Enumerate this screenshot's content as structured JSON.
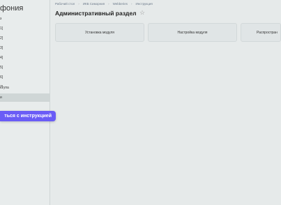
{
  "sidebar": {
    "title": "фония",
    "items": [
      {
        "label": "з"
      },
      {
        "label": "1]"
      },
      {
        "label": "2]"
      },
      {
        "label": "3]"
      },
      {
        "label": "4]"
      },
      {
        "label": "5]"
      },
      {
        "label": "6]"
      },
      {
        "label": "7]"
      },
      {
        "label": "ступа"
      },
      {
        "label": "и"
      }
    ]
  },
  "cta": {
    "label": "ться с инструкцией"
  },
  "breadcrumb": [
    "Рабочий стол",
    "ИКБ Симорния",
    "Webberies",
    "Инструкция"
  ],
  "page": {
    "title": "Административный раздел"
  },
  "cards": [
    {
      "label": "Установка модуля"
    },
    {
      "label": "Настройка модуля"
    },
    {
      "label": "Распростран"
    }
  ],
  "colors": {
    "accent": "#6a5cf6",
    "background": "#e6eaea"
  }
}
